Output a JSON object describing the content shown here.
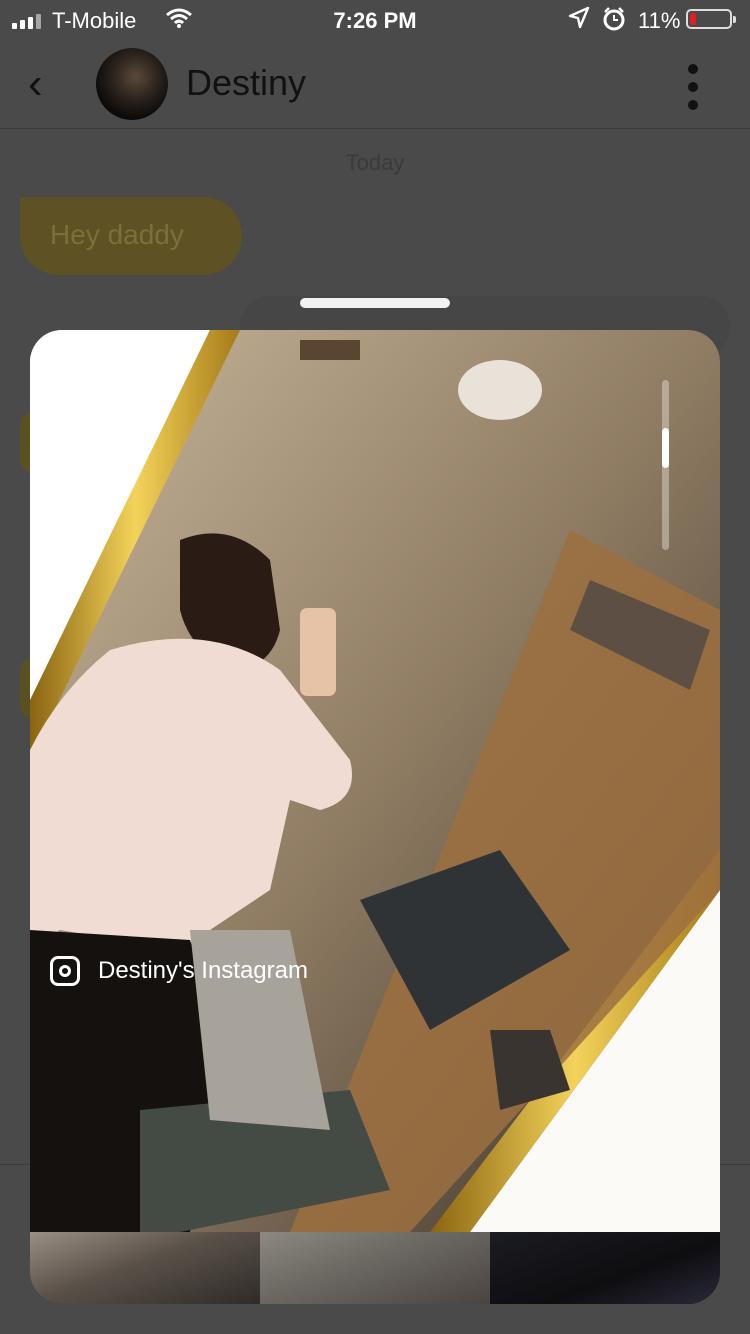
{
  "status_bar": {
    "carrier": "T-Mobile",
    "time": "7:26 PM",
    "battery_percent": "11%",
    "battery_level": 0.11,
    "icons": [
      "signal-icon",
      "wifi-icon",
      "location-icon",
      "alarm-icon",
      "battery-icon"
    ]
  },
  "header": {
    "back_icon": "‹",
    "contact_name": "Destiny",
    "menu_icon": "kebab-icon"
  },
  "chat": {
    "date_label": "Today",
    "messages": [
      {
        "text": "Hey daddy"
      }
    ]
  },
  "sheet": {
    "source_label": "Destiny's Instagram",
    "source_icon": "instagram-icon"
  },
  "colors": {
    "overlay_bg": "#4a4a4a",
    "bubble_bg": "#5e5224",
    "battery_low": "#e02020"
  }
}
